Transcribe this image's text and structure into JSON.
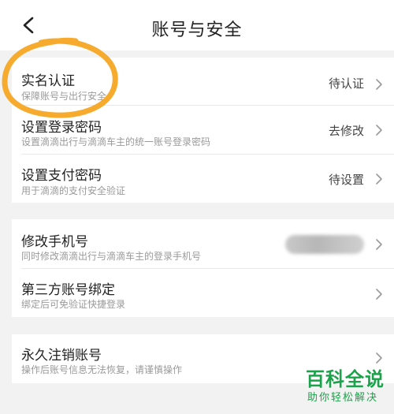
{
  "header": {
    "title": "账号与安全",
    "back_icon": "chevron-left-icon"
  },
  "group1": [
    {
      "title": "实名认证",
      "subtitle": "保障账号与出行安全",
      "status": "待认证"
    },
    {
      "title": "设置登录密码",
      "subtitle": "设置滴滴出行与滴滴车主的统一账号登录密码",
      "status": "去修改"
    },
    {
      "title": "设置支付密码",
      "subtitle": "用于滴滴的支付安全验证",
      "status": "待设置"
    }
  ],
  "group2": [
    {
      "title": "修改手机号",
      "subtitle": "同时修改滴滴出行与滴滴车主的登录手机号",
      "status": ""
    },
    {
      "title": "第三方账号绑定",
      "subtitle": "绑定后可免验证快捷登录",
      "status": ""
    }
  ],
  "group3": [
    {
      "title": "永久注销账号",
      "subtitle": "操作后账号信息无法恢复，请谨慎操作",
      "status": ""
    }
  ],
  "watermark": {
    "main": "百科全说",
    "sub": "助你轻松解决"
  },
  "colors": {
    "annotation": "#f5a623",
    "watermark": "#1aa34a",
    "background": "#f2f2f2"
  }
}
